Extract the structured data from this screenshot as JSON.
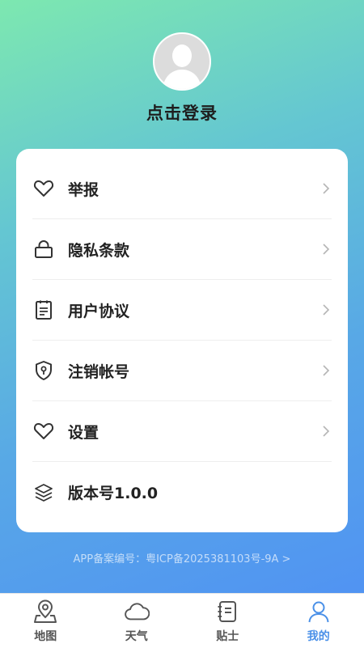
{
  "profile": {
    "login_label": "点击登录"
  },
  "menu": {
    "items": [
      {
        "label": "举报",
        "icon": "heart-icon",
        "has_arrow": true
      },
      {
        "label": "隐私条款",
        "icon": "lock-icon",
        "has_arrow": true
      },
      {
        "label": "用户协议",
        "icon": "document-icon",
        "has_arrow": true
      },
      {
        "label": "注销帐号",
        "icon": "shield-icon",
        "has_arrow": true
      },
      {
        "label": "设置",
        "icon": "heart-icon",
        "has_arrow": true
      },
      {
        "label": "版本号1.0.0",
        "icon": "layers-icon",
        "has_arrow": false
      }
    ]
  },
  "footer": {
    "icp": "APP备案编号：粤ICP备2025381103号-9A >"
  },
  "tabbar": {
    "tabs": [
      {
        "label": "地图",
        "icon": "map-pin-icon",
        "active": false
      },
      {
        "label": "天气",
        "icon": "cloud-icon",
        "active": false
      },
      {
        "label": "贴士",
        "icon": "notebook-icon",
        "active": false
      },
      {
        "label": "我的",
        "icon": "person-icon",
        "active": true
      }
    ]
  },
  "colors": {
    "accent": "#4a90e8",
    "icon": "#333333",
    "chevron": "#b5b5b5"
  }
}
